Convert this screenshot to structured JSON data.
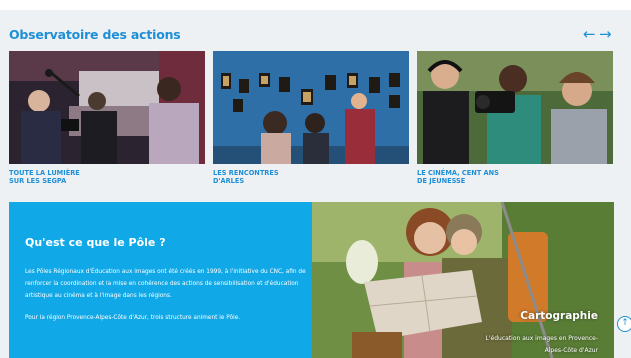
{
  "section": {
    "title": "Observatoire des actions",
    "prev_icon": "←",
    "next_icon": "→"
  },
  "cards": [
    {
      "caption": "TOUTE LA LUMIÈRE\nSUR LES SEGPA",
      "image": "students-filming-school-corridor"
    },
    {
      "caption": "LES RENCONTRES\nD'ARLES",
      "image": "visitors-photography-exhibition-blue-wall"
    },
    {
      "caption": "LE CINÉMA, CENT ANS\nDE JEUNESSE",
      "image": "teenagers-with-camera-and-headphones"
    }
  ],
  "pole": {
    "title": "Qu'est ce que le Pôle ?",
    "paragraph_1": "Les Pôles Régionaux d'Éducation aux images ont été créés en 1999, à l'initiative du CNC, afin de renforcer la coordination et la mise en cohérence des actions de sensibilisation et d'éducation artistique au cinéma et à l'image dans les régions.",
    "paragraph_2": "Pour la région Provence-Alpes-Côte d'Azur, trois structure animent le Pôle."
  },
  "cartographie": {
    "title": "Cartographie",
    "subtitle": "L'éducation aux images en Provence-Alpes-Côte d'Azur",
    "image": "two-children-scouts-reading-a-map"
  },
  "scroll_top_icon": "↑",
  "colors": {
    "accent": "#1e8fd6",
    "pole_background": "#10a8e6",
    "page_background": "#eef1f4"
  }
}
